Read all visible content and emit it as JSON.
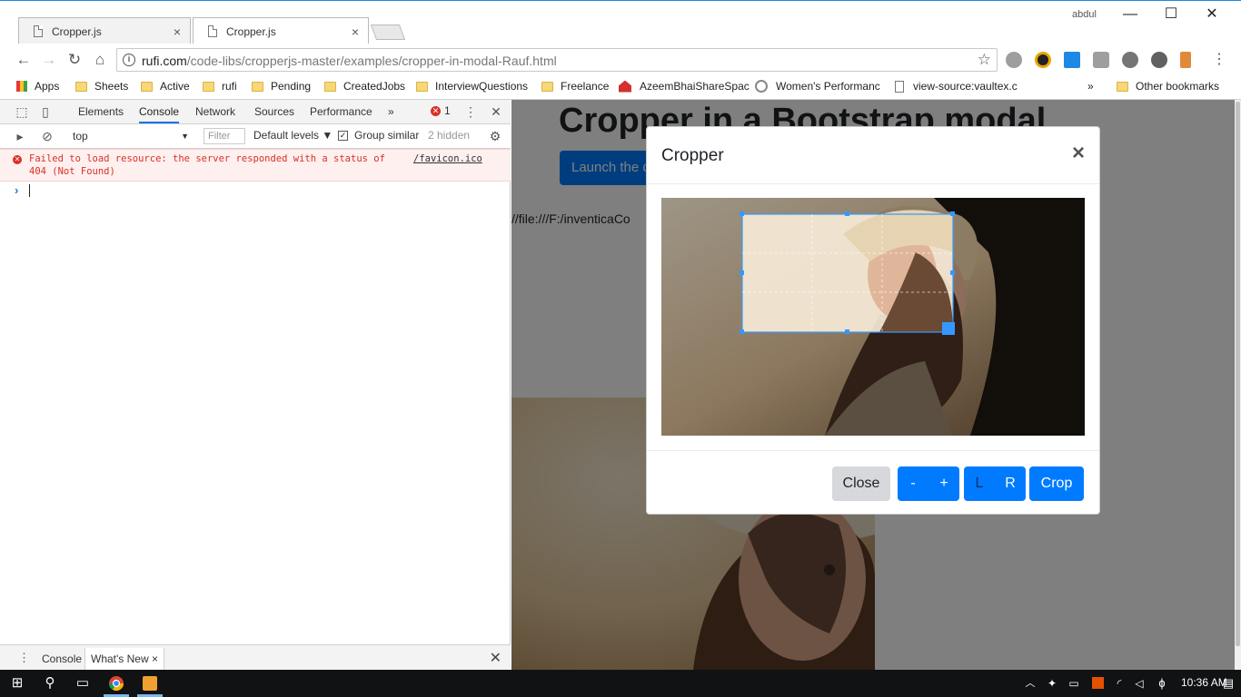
{
  "browser": {
    "tabs": [
      {
        "title": "Cropper.js",
        "close": "×"
      },
      {
        "title": "Cropper.js",
        "close": "×"
      }
    ],
    "user": "abdul",
    "window_controls": {
      "minimize": "—",
      "maximize": "☐",
      "close": "✕"
    },
    "url_host": "rufi.com",
    "url_path": "/code-libs/cropperjs-master/examples/cropper-in-modal-Rauf.html",
    "bookmarks": [
      {
        "label": "Apps",
        "icon": "apps-grid-icon"
      },
      {
        "label": "Sheets",
        "icon": "folder-icon"
      },
      {
        "label": "Active",
        "icon": "folder-icon"
      },
      {
        "label": "rufi",
        "icon": "folder-icon"
      },
      {
        "label": "Pending",
        "icon": "folder-icon"
      },
      {
        "label": "CreatedJobs",
        "icon": "folder-icon"
      },
      {
        "label": "InterviewQuestions",
        "icon": "folder-icon"
      },
      {
        "label": "Freelance",
        "icon": "folder-icon"
      },
      {
        "label": "AzeemBhaiShareSpac",
        "icon": "red-site-icon"
      },
      {
        "label": "Women's Performanc",
        "icon": "w-site-icon"
      },
      {
        "label": "view-source:vaultex.c",
        "icon": "page-icon"
      }
    ],
    "bookmarks_more": "»",
    "other_bookmarks": "Other bookmarks"
  },
  "devtools": {
    "tabs": [
      "Elements",
      "Console",
      "Network",
      "Sources",
      "Performance"
    ],
    "active_tab": "Console",
    "more_tabs": "»",
    "error_count": "1",
    "context": "top",
    "filter_placeholder": "Filter",
    "levels": "Default levels ▼",
    "group_similar": "Group similar",
    "hidden_count": "2 hidden",
    "error_message_line1": "Failed to load resource: the server responded with a status of",
    "error_message_line2": "404 (Not Found)",
    "error_source": "/favicon.ico",
    "prompt": "›",
    "drawer_tabs": [
      "Console",
      "What's New"
    ],
    "drawer_tab_close": "×"
  },
  "page": {
    "heading": "Cropper in a Bootstrap modal",
    "launch_button": "Launch the demo",
    "file_path": "//file:///F:/inventicaCo"
  },
  "modal": {
    "title": "Cropper",
    "close": "×",
    "buttons": {
      "close": "Close",
      "zoom_out": "-",
      "zoom_in": "+",
      "rotate_left": "L",
      "rotate_right": "R",
      "crop": "Crop"
    }
  },
  "taskbar": {
    "time": "10:36 AM"
  },
  "colors": {
    "primary": "#007bff",
    "error": "#d93025",
    "taskbar": "#101214"
  }
}
